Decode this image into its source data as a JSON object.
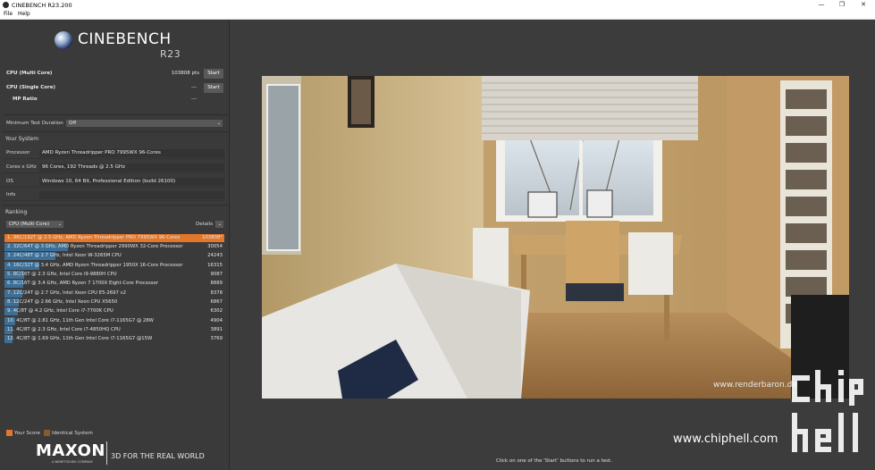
{
  "window": {
    "title": "CINEBENCH R23.200",
    "minimize": "—",
    "restore": "❐",
    "close": "✕"
  },
  "menu": {
    "file": "File",
    "help": "Help"
  },
  "logo": {
    "name": "CINEBENCH",
    "version": "R23"
  },
  "cpu_multi": {
    "label": "CPU (Multi Core)",
    "value": "103808 pts",
    "button": "Start"
  },
  "cpu_single": {
    "label": "CPU (Single Core)",
    "value": "---",
    "button": "Start"
  },
  "mp_ratio": {
    "label": "MP Ratio",
    "value": "---"
  },
  "min_duration": {
    "label": "Minimum Test Duration",
    "value": "Off"
  },
  "your_system": {
    "title": "Your System",
    "rows": [
      {
        "key": "Processor",
        "value": "AMD Ryzen Threadripper PRO 7995WX 96-Cores"
      },
      {
        "key": "Cores x GHz",
        "value": "96 Cores, 192 Threads @ 2.5 GHz"
      },
      {
        "key": "OS",
        "value": "Windows 10, 64 Bit, Professional Edition (build 26100)"
      },
      {
        "key": "Info",
        "value": ""
      }
    ]
  },
  "ranking": {
    "title": "Ranking",
    "filter": "CPU (Multi Core)",
    "details": "Details",
    "max_score": 103808,
    "rows": [
      {
        "label": "1. 96C/192T @ 2.5 GHz, AMD Ryzen Threadripper PRO 7995WX 96-Cores",
        "score": "103808*",
        "value": 103808
      },
      {
        "label": "2. 32C/64T @ 3 GHz, AMD Ryzen Threadripper 2990WX 32-Core Processor",
        "score": "30054",
        "value": 30054
      },
      {
        "label": "3. 24C/48T @ 2.7 GHz, Intel Xeon W-3265M CPU",
        "score": "24243",
        "value": 24243
      },
      {
        "label": "4. 16C/32T @ 3.4 GHz, AMD Ryzen Threadripper 1950X 16-Core Processor",
        "score": "16315",
        "value": 16315
      },
      {
        "label": "5. 8C/16T @ 2.3 GHz, Intel Core i9-9880H CPU",
        "score": "9087",
        "value": 9087
      },
      {
        "label": "6. 8C/16T @ 3.4 GHz, AMD Ryzen 7 1700X Eight-Core Processor",
        "score": "8889",
        "value": 8889
      },
      {
        "label": "7. 12C/24T @ 2.7 GHz, Intel Xeon CPU E5-2697 v2",
        "score": "8378",
        "value": 8378
      },
      {
        "label": "8. 12C/24T @ 2.66 GHz, Intel Xeon CPU X5650",
        "score": "6867",
        "value": 6867
      },
      {
        "label": "9. 4C/8T @ 4.2 GHz, Intel Core i7-7700K CPU",
        "score": "6302",
        "value": 6302
      },
      {
        "label": "10. 4C/8T @ 2.81 GHz, 11th Gen Intel Core i7-1165G7 @ 28W",
        "score": "4904",
        "value": 4904
      },
      {
        "label": "11. 4C/8T @ 2.3 GHz, Intel Core i7-4850HQ CPU",
        "score": "3891",
        "value": 3891
      },
      {
        "label": "12. 4C/8T @ 1.69 GHz, 11th Gen Intel Core i7-1165G7 @15W",
        "score": "3769",
        "value": 3769
      }
    ]
  },
  "legend": {
    "your_score": "Your Score",
    "identical": "Identical System",
    "your_color": "#e2772b",
    "identical_color": "#8a5a2b",
    "bar_color": "#3d6f96"
  },
  "footer": {
    "brand": "MAXON",
    "brand_sub": "A NEMETSCHEK COMPANY",
    "tagline": "3D FOR THE REAL WORLD"
  },
  "render": {
    "watermark": "www.renderbaron.de"
  },
  "status": "Click on one of the 'Start' buttons to run a test.",
  "site_watermark": "www.chiphell.com",
  "site_logo": "chip hell"
}
